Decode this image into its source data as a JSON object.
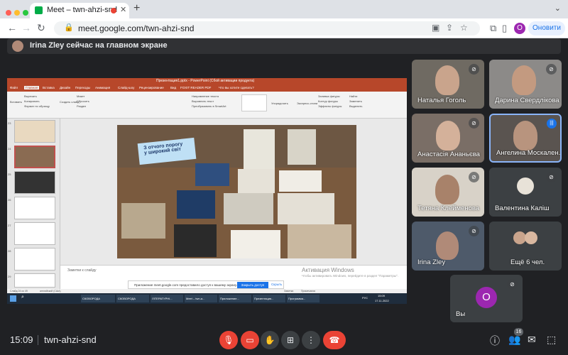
{
  "browser": {
    "tab_title": "Meet – twn-ahzi-snd",
    "url": "meet.google.com/twn-ahzi-snd",
    "profile_initial": "O",
    "update_label": "Оновити"
  },
  "presenter_banner": "Irina Zley сейчас на главном экране",
  "shared_screen": {
    "window_title": "Презентация1.pptx - PowerPoint (Сбой активации продукта)",
    "ribbon_tabs": [
      "Файл",
      "Главная",
      "Вставка",
      "Дизайн",
      "Переходы",
      "Анимация",
      "Слайд-шоу",
      "Рецензирование",
      "Вид",
      "FOXIT READER PDF",
      "Что вы хотите сделать?"
    ],
    "ribbon_items": [
      "Вставить",
      "Вырезать",
      "Копировать",
      "Формат по образцу",
      "Создать слайд",
      "Макет",
      "Сбросить",
      "Раздел",
      "Направление текста",
      "Выровнять текст",
      "Преобразовать в SmartArt",
      "Упорядочить",
      "Экспресс-стили",
      "Заливка фигуры",
      "Контур фигуры",
      "Эффекты фигуры",
      "Найти",
      "Заменить",
      "Выделить"
    ],
    "slide_numbers": [
      "23",
      "24",
      "25",
      "26",
      "27",
      "28",
      "29"
    ],
    "slide_text_1": "З отчого порогу",
    "slide_text_2": "у широкий світ",
    "notes_placeholder": "Заметки к слайду",
    "activation_title": "Активация Windows",
    "activation_body": "Чтобы активировать Windows, перейдите в раздел \"Параметры\".",
    "notice_text": "Приложение meet.google.com предоставило доступ к вашему экрану.",
    "notice_stop": "Закрыть доступ",
    "notice_hide": "Скрыть",
    "status_slide": "Слайд 24 из 49",
    "status_lang": "английский (США)",
    "status_notes": "Заметки",
    "status_comments": "Примечания",
    "taskbar_items": [
      "СКОВОРОДА",
      "СКОВОРОДА",
      "ЛІТЕРАТУРНІ...",
      "Meet – twn-a...",
      "Приложение...",
      "Презентация...",
      "Программа..."
    ],
    "taskbar_time": "15:09",
    "taskbar_date": "17.11.2022",
    "taskbar_lang": "РУС"
  },
  "participants": [
    {
      "name": "Наталья Гоголь",
      "muted": true
    },
    {
      "name": "Дарина Свердлікова",
      "muted": true
    },
    {
      "name": "Анастасія Ананьєва",
      "muted": true
    },
    {
      "name": "Ангелина Москален...",
      "muted": false,
      "speaking": true
    },
    {
      "name": "Тетяна Клейменова",
      "muted": true
    },
    {
      "name": "Валентина Каліш",
      "muted": true
    },
    {
      "name": "Irina Zley",
      "muted": true
    },
    {
      "name": "Ещё 6 чел.",
      "muted": false
    },
    {
      "name": "Вы",
      "initial": "O",
      "muted": true
    }
  ],
  "bottom_bar": {
    "time": "15:09",
    "meeting_code": "twn-ahzi-snd",
    "participants_count": "16"
  },
  "colors": {
    "accent": "#1a73e8",
    "danger": "#ea4335",
    "bg": "#202124",
    "tile": "#3c4043",
    "self_avatar": "#9c27b0"
  }
}
